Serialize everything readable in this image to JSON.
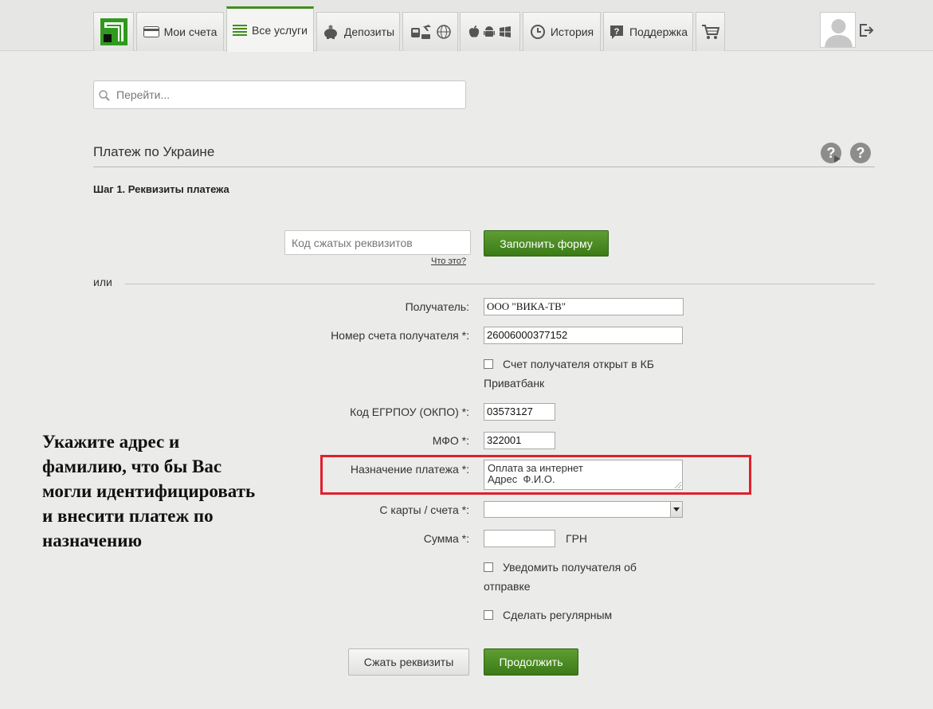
{
  "nav": {
    "tabs": [
      {
        "id": "my-accounts",
        "label": "Мои счета"
      },
      {
        "id": "all-services",
        "label": "Все услуги"
      },
      {
        "id": "deposits",
        "label": "Депозиты"
      },
      {
        "id": "history",
        "label": "История"
      },
      {
        "id": "support",
        "label": "Поддержка"
      }
    ],
    "accent": "#3f8d1e"
  },
  "search": {
    "placeholder": "Перейти..."
  },
  "page": {
    "title": "Платеж по Украине",
    "step": "Шаг 1. Реквизиты платежа"
  },
  "compressed": {
    "placeholder": "Код сжатых реквизитов",
    "what_link": "Что это?",
    "fill_button": "Заполнить форму"
  },
  "or_label": "или",
  "form": {
    "recipient_label": "Получатель:",
    "recipient_value": "ООО \"ВИКА-ТВ\"",
    "account_label": "Номер счета получателя *:",
    "account_value": "26006000377152",
    "privat_checkbox_line1": "Счет получателя открыт в КБ",
    "privat_checkbox_line2": "Приватбанк",
    "edrpou_label": "Код ЕГРПОУ (ОКПО) *:",
    "edrpou_value": "03573127",
    "mfo_label": "МФО *:",
    "mfo_value": "322001",
    "purpose_label": "Назначение платежа *:",
    "purpose_line1": "Оплата за интернет",
    "purpose_line2": "Адрес  Ф.И.О.",
    "card_label": "С карты / счета *:",
    "card_value": "",
    "amount_label": "Сумма *:",
    "amount_value": "",
    "currency": "ГРН",
    "notify_line1": "Уведомить получателя об",
    "notify_line2": "отправке",
    "regular": "Сделать регулярным",
    "compress_button": "Сжать реквизиты",
    "continue_button": "Продолжить"
  },
  "annotation": {
    "lines": [
      "Укажите адрес и",
      "фамилию, что бы Вас",
      "могли идентифицировать",
      "и внесити платеж по",
      "назначению"
    ],
    "highlight_color": "#e0202c"
  }
}
